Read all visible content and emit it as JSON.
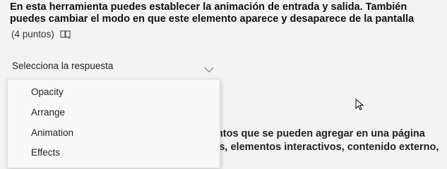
{
  "question": {
    "number_fragment": ".",
    "line1": "En esta herramienta puedes establecer la animación de entrada y salida. También",
    "line2": "puedes cambiar el modo en que este elemento aparece y desaparece de la pantalla",
    "points": "(4 puntos)",
    "reader_icon": "immersive-reader-icon"
  },
  "select": {
    "label": "Selecciona la respuesta",
    "icon": "chevron-down-icon",
    "options": [
      "Opacity",
      "Arrange",
      "Animation",
      "Effects"
    ]
  },
  "background_text": {
    "line1": "nentos que se pueden agregar en una página",
    "line2": "'sos, elementos interactivos, contenido externo,"
  },
  "colors": {
    "background": "#f3f3f3",
    "dropdown": "#f9f9f9"
  }
}
